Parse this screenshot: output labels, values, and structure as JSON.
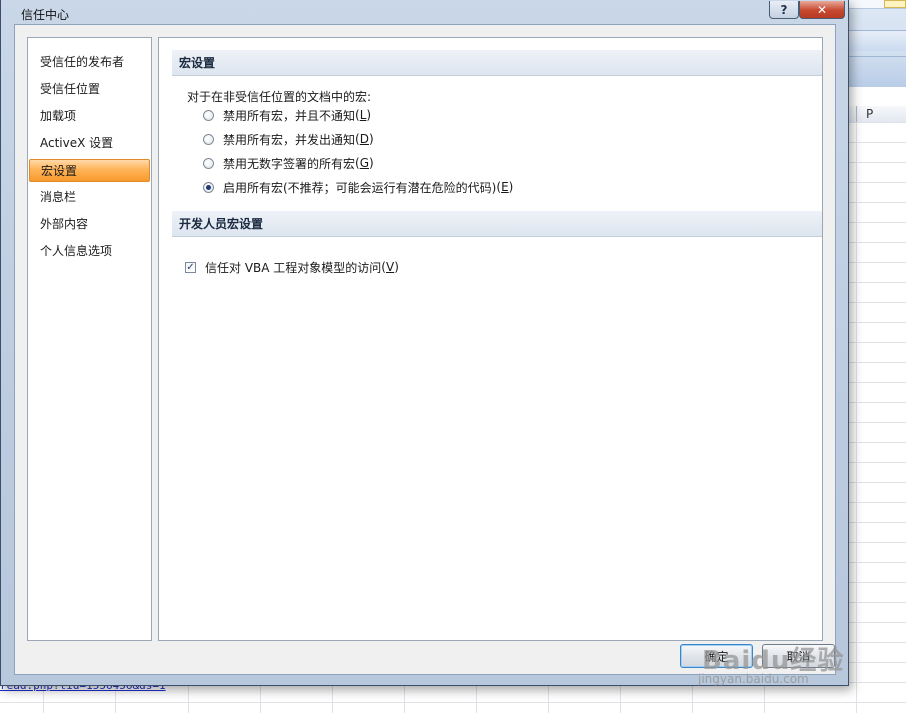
{
  "background": {
    "column_header": "P",
    "status_link": "read.php?tid=1556456&ds=1"
  },
  "dialog": {
    "title": "信任中心",
    "help_label": "?",
    "close_label": "✕",
    "nav": {
      "items": [
        {
          "label": "受信任的发布者",
          "selected": false
        },
        {
          "label": "受信任位置",
          "selected": false
        },
        {
          "label": "加载项",
          "selected": false
        },
        {
          "label": "ActiveX 设置",
          "selected": false
        },
        {
          "label": "宏设置",
          "selected": true
        },
        {
          "label": "消息栏",
          "selected": false
        },
        {
          "label": "外部内容",
          "selected": false
        },
        {
          "label": "个人信息选项",
          "selected": false
        }
      ]
    },
    "macro_settings": {
      "header": "宏设置",
      "intro": "对于在非受信任位置的文档中的宏:",
      "options": [
        {
          "label": "禁用所有宏，并且不通知",
          "key": "L",
          "selected": false
        },
        {
          "label": "禁用所有宏，并发出通知",
          "key": "D",
          "selected": false
        },
        {
          "label": "禁用无数字签署的所有宏",
          "key": "G",
          "selected": false
        },
        {
          "label": "启用所有宏(不推荐；可能会运行有潜在危险的代码)",
          "key": "E",
          "selected": true
        }
      ]
    },
    "developer_settings": {
      "header": "开发人员宏设置",
      "vba_checkbox": {
        "label": "信任对 VBA 工程对象模型的访问",
        "key": "V",
        "checked": true
      }
    },
    "buttons": {
      "ok": "确定",
      "cancel": "取消"
    }
  },
  "watermark": {
    "logo": "Baidu经验",
    "url": "jingyan.baidu.com"
  },
  "colors": {
    "selected_nav": "#f89a2c",
    "dialog_frame": "#bccbe0",
    "close_button": "#c7482f"
  }
}
